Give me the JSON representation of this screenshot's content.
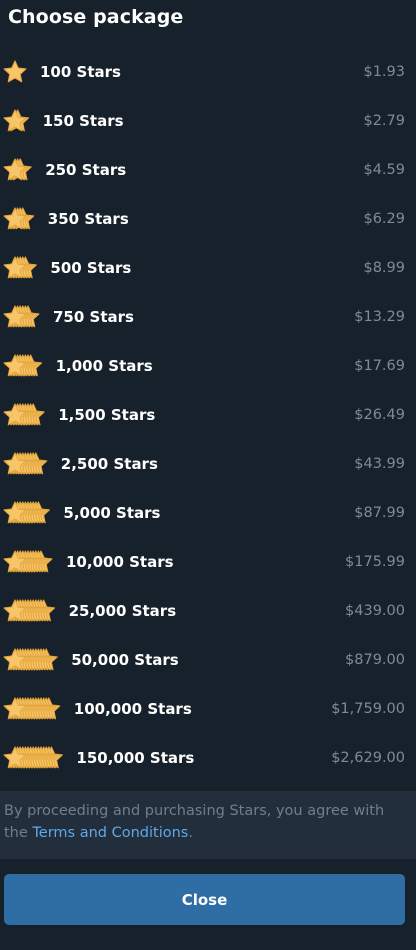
{
  "header": {
    "title": "Choose package"
  },
  "packages": [
    {
      "label": "100 Stars",
      "price": "$1.93",
      "star_count": 1
    },
    {
      "label": "150 Stars",
      "price": "$2.79",
      "star_count": 2
    },
    {
      "label": "250 Stars",
      "price": "$4.59",
      "star_count": 3
    },
    {
      "label": "350 Stars",
      "price": "$6.29",
      "star_count": 4
    },
    {
      "label": "500 Stars",
      "price": "$8.99",
      "star_count": 5
    },
    {
      "label": "750 Stars",
      "price": "$13.29",
      "star_count": 6
    },
    {
      "label": "1,000 Stars",
      "price": "$17.69",
      "star_count": 7
    },
    {
      "label": "1,500 Stars",
      "price": "$26.49",
      "star_count": 8
    },
    {
      "label": "2,500 Stars",
      "price": "$43.99",
      "star_count": 9
    },
    {
      "label": "5,000 Stars",
      "price": "$87.99",
      "star_count": 10
    },
    {
      "label": "10,000 Stars",
      "price": "$175.99",
      "star_count": 11
    },
    {
      "label": "25,000 Stars",
      "price": "$439.00",
      "star_count": 12
    },
    {
      "label": "50,000 Stars",
      "price": "$879.00",
      "star_count": 13
    },
    {
      "label": "100,000 Stars",
      "price": "$1,759.00",
      "star_count": 14
    },
    {
      "label": "150,000 Stars",
      "price": "$2,629.00",
      "star_count": 15
    }
  ],
  "footer": {
    "note_prefix": "By proceeding and purchasing Stars, you agree with the ",
    "terms_link": "Terms and Conditions",
    "note_suffix": ".",
    "close_label": "Close"
  },
  "icons": {
    "package_icon": "star-stack-icon"
  },
  "colors": {
    "background": "#17212b",
    "star_fill": "#f7c66a",
    "star_stroke": "#e4a63c",
    "price_text": "#7d8b99",
    "link": "#5fa8e8",
    "button": "#2f6ea5"
  }
}
